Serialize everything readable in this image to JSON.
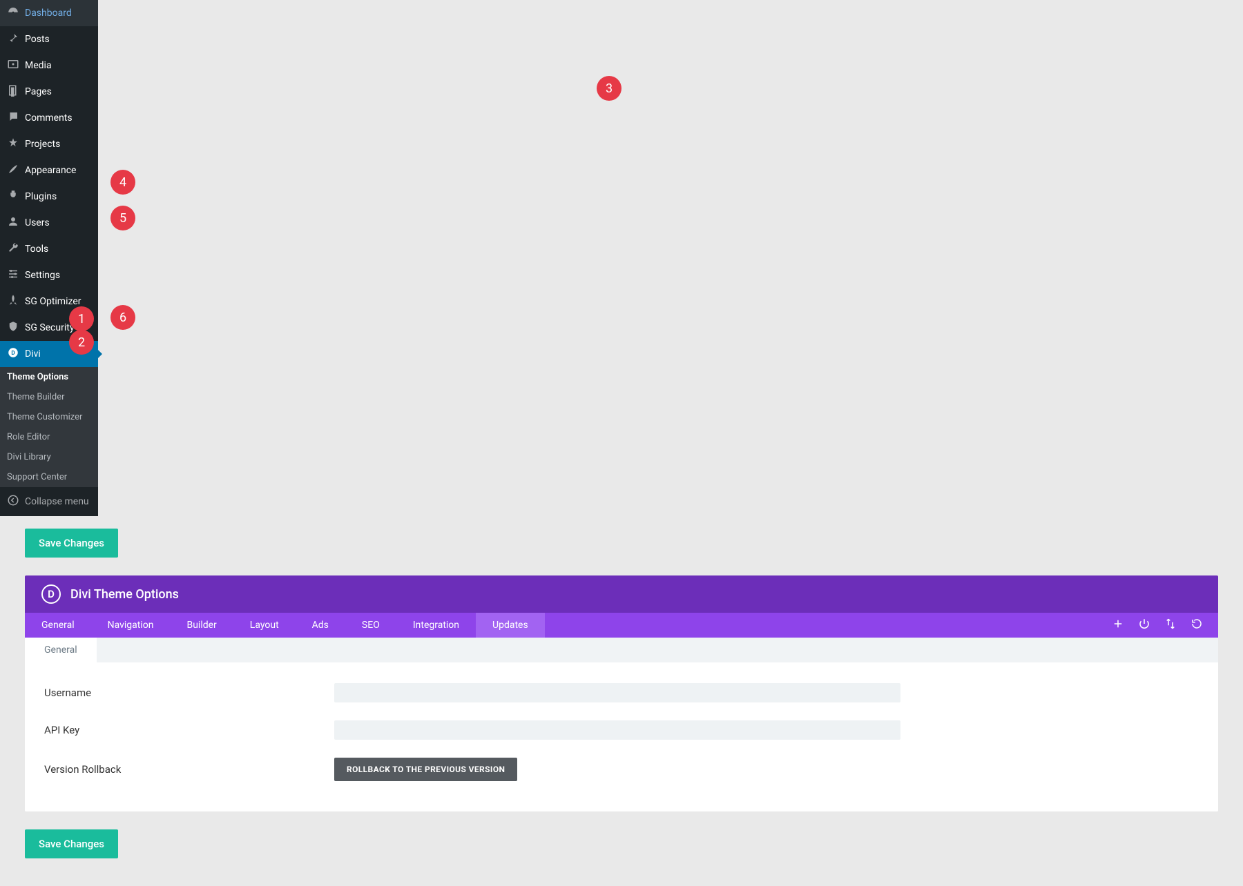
{
  "sidebar": {
    "items": [
      {
        "label": "Dashboard",
        "icon": "dashboard"
      },
      {
        "label": "Posts",
        "icon": "pin"
      },
      {
        "label": "Media",
        "icon": "media"
      },
      {
        "label": "Pages",
        "icon": "page"
      },
      {
        "label": "Comments",
        "icon": "comment"
      },
      {
        "label": "Projects",
        "icon": "star"
      },
      {
        "label": "Appearance",
        "icon": "brush"
      },
      {
        "label": "Plugins",
        "icon": "plug"
      },
      {
        "label": "Users",
        "icon": "user"
      },
      {
        "label": "Tools",
        "icon": "wrench"
      },
      {
        "label": "Settings",
        "icon": "sliders"
      },
      {
        "label": "SG Optimizer",
        "icon": "rocket"
      },
      {
        "label": "SG Security",
        "icon": "shield"
      },
      {
        "label": "Divi",
        "icon": "divi",
        "active": true
      }
    ],
    "submenu": [
      {
        "label": "Theme Options",
        "active": true
      },
      {
        "label": "Theme Builder"
      },
      {
        "label": "Theme Customizer"
      },
      {
        "label": "Role Editor"
      },
      {
        "label": "Divi Library"
      },
      {
        "label": "Support Center"
      }
    ],
    "collapse": "Collapse menu"
  },
  "header": {
    "save": "Save Changes",
    "panel_title": "Divi Theme Options",
    "tabs": [
      "General",
      "Navigation",
      "Builder",
      "Layout",
      "Ads",
      "SEO",
      "Integration",
      "Updates"
    ],
    "active_tab": "Updates",
    "subtabs": [
      "General"
    ],
    "active_subtab": "General"
  },
  "fields": {
    "username_label": "Username",
    "username_value": "",
    "apikey_label": "API Key",
    "apikey_value": "",
    "rollback_label": "Version Rollback",
    "rollback_btn": "ROLLBACK TO THE PREVIOUS VERSION"
  },
  "footer": {
    "save": "Save Changes"
  },
  "annotations": {
    "1": "1",
    "2": "2",
    "3": "3",
    "4": "4",
    "5": "5",
    "6": "6"
  },
  "colors": {
    "accent": "#1abc9c",
    "purple": "#6c2eb9",
    "purple_light": "#8e44ea",
    "red": "#e63946"
  }
}
